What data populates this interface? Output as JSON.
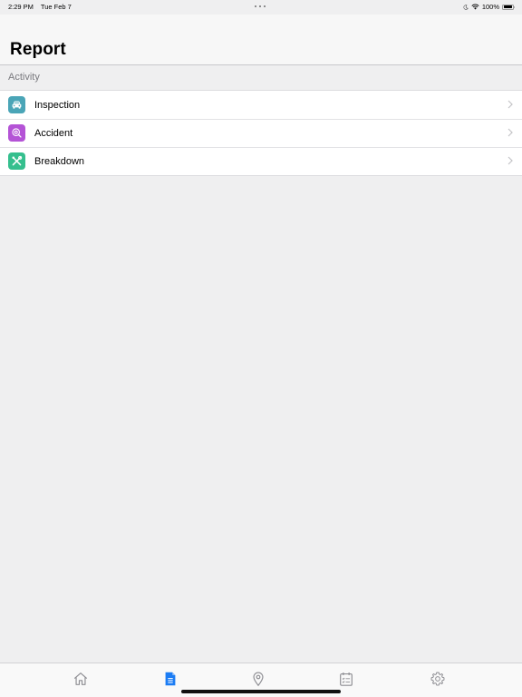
{
  "status_bar": {
    "time": "2:29 PM",
    "date": "Tue Feb 7",
    "battery_percent": "100%",
    "icons": [
      "moon-icon",
      "wifi-icon",
      "battery-icon"
    ]
  },
  "header": {
    "title": "Report"
  },
  "activity": {
    "section_label": "Activity",
    "items": [
      {
        "label": "Inspection",
        "icon": "car-icon",
        "color": "#4aa5b7"
      },
      {
        "label": "Accident",
        "icon": "accident-icon",
        "color": "#b453d6"
      },
      {
        "label": "Breakdown",
        "icon": "tools-icon",
        "color": "#35bf8e"
      }
    ]
  },
  "tab_bar": {
    "active_color": "#1b7cf4",
    "inactive_color": "#8e8e93",
    "tabs": [
      {
        "icon": "home-icon",
        "active": false
      },
      {
        "icon": "report-icon",
        "active": true
      },
      {
        "icon": "location-icon",
        "active": false
      },
      {
        "icon": "calendar-checklist-icon",
        "active": false
      },
      {
        "icon": "settings-icon",
        "active": false
      }
    ]
  }
}
